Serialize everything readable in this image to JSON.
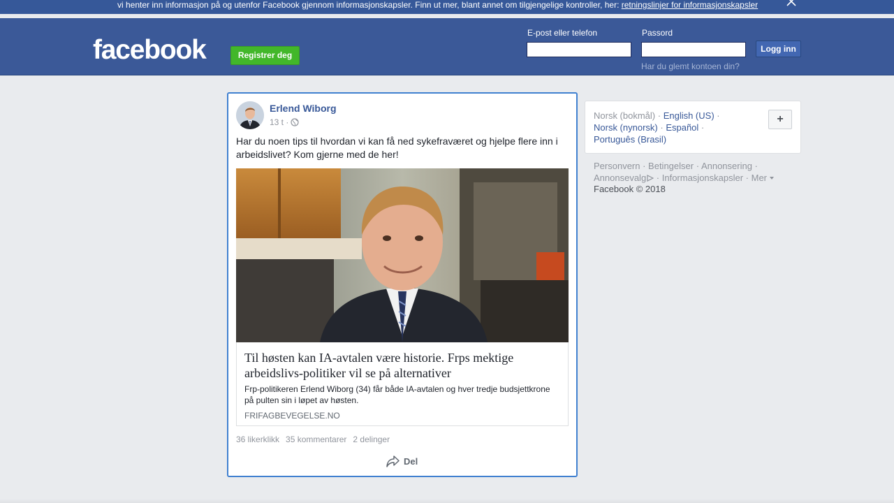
{
  "cookie_banner": {
    "text": "vi henter inn informasjon på og utenfor Facebook gjennom informasjonskapsler. Finn ut mer, blant annet om tilgjengelige kontroller, her: ",
    "link_text": "retningslinjer for informasjonskapsler",
    "close_icon": "close-icon"
  },
  "header": {
    "logo": "facebook",
    "register_label": "Registrer deg",
    "email_label": "E-post eller telefon",
    "email_value": "",
    "password_label": "Passord",
    "password_value": "",
    "login_label": "Logg inn",
    "forgot_label": "Har du glemt kontoen din?"
  },
  "post": {
    "author": "Erlend Wiborg",
    "time": "13 t ·",
    "privacy_icon": "globe-icon",
    "text": "Har du noen tips til hvordan vi kan få ned sykefraværet og hjelpe flere inn i arbeidslivet? Kom gjerne med de her!",
    "link": {
      "title": "Til høsten kan IA-avtalen være historie. Frps mektige arbeidslivs-politiker vil se på alternativer",
      "description": "Frp-politikeren Erlend Wiborg (34) får både IA-avtalen og hver tredje budsjettkrone på pulten sin i løpet av høsten.",
      "domain": "FRIFAGBEVEGELSE.NO"
    },
    "stats": {
      "likes": "36 likerklikk",
      "comments": "35 kommentarer",
      "shares": "2 delinger"
    },
    "share_label": "Del",
    "share_icon": "share-arrow-icon"
  },
  "sidebar": {
    "languages": {
      "current": "Norsk (bokmål)",
      "sep": " · ",
      "options": [
        "English (US)",
        "Norsk (nynorsk)",
        "Español",
        "Português (Brasil)"
      ],
      "add_label": "+"
    },
    "footer": {
      "links": [
        "Personvern",
        "Betingelser",
        "Annonsering",
        "Annonsevalg",
        "Informasjonskapsler",
        "Mer"
      ],
      "adchoices_icon": "adchoices-icon",
      "more_icon": "dropdown-caret-icon",
      "copyright": "Facebook © 2018"
    }
  },
  "colors": {
    "brand": "#3b5998",
    "register_green": "#42b72a",
    "link_blue": "#385898",
    "highlight_border": "#4080d0"
  }
}
